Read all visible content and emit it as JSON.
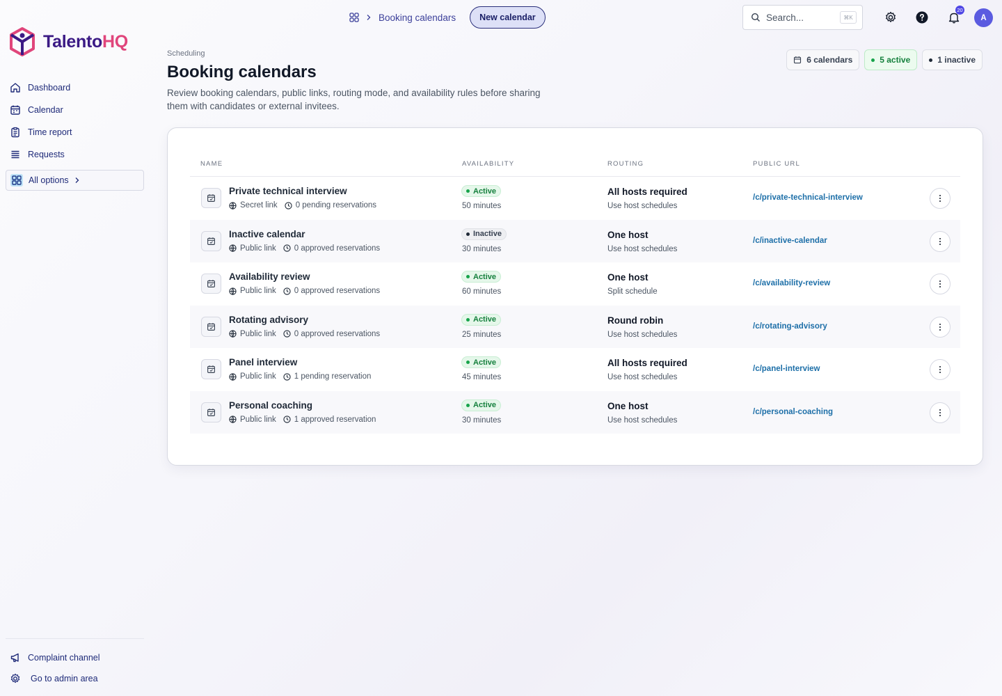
{
  "app": {
    "brand_part1": "Talento",
    "brand_part2": "HQ"
  },
  "sidebar": {
    "items": [
      {
        "label": "Dashboard",
        "icon": "home-icon"
      },
      {
        "label": "Calendar",
        "icon": "calendar-icon"
      },
      {
        "label": "Time report",
        "icon": "clipboard-icon"
      },
      {
        "label": "Requests",
        "icon": "list-icon"
      }
    ],
    "all_options": "All options",
    "bottom": [
      {
        "label": "Complaint channel",
        "icon": "megaphone-icon"
      },
      {
        "label": "Go to admin area",
        "icon": "gear-icon"
      }
    ]
  },
  "topbar": {
    "breadcrumb": "Booking calendars",
    "new_calendar": "New calendar",
    "search_placeholder": "Search...",
    "search_shortcut": "⌘K",
    "notification_count": "20",
    "avatar_initial": "A"
  },
  "header": {
    "eyebrow": "Scheduling",
    "title": "Booking calendars",
    "description": "Review booking calendars, public links, routing mode, and availability rules before sharing them with candidates or external invitees.",
    "stats": {
      "calendars": "6 calendars",
      "active": "5 active",
      "inactive": "1 inactive"
    }
  },
  "table": {
    "columns": [
      "NAME",
      "AVAILABILITY",
      "ROUTING",
      "PUBLIC URL"
    ],
    "rows": [
      {
        "name": "Private technical interview",
        "link": "Secret link",
        "reservations": "0 pending reservations",
        "status": "Active",
        "duration": "50 minutes",
        "routing": "All hosts required",
        "schedule": "Use host schedules",
        "url": "/c/private-technical-interview"
      },
      {
        "name": "Inactive calendar",
        "link": "Public link",
        "reservations": "0 approved reservations",
        "status": "Inactive",
        "duration": "30 minutes",
        "routing": "One host",
        "schedule": "Use host schedules",
        "url": "/c/inactive-calendar"
      },
      {
        "name": "Availability review",
        "link": "Public link",
        "reservations": "0 approved reservations",
        "status": "Active",
        "duration": "60 minutes",
        "routing": "One host",
        "schedule": "Split schedule",
        "url": "/c/availability-review"
      },
      {
        "name": "Rotating advisory",
        "link": "Public link",
        "reservations": "0 approved reservations",
        "status": "Active",
        "duration": "25 minutes",
        "routing": "Round robin",
        "schedule": "Use host schedules",
        "url": "/c/rotating-advisory"
      },
      {
        "name": "Panel interview",
        "link": "Public link",
        "reservations": "1 pending reservation",
        "status": "Active",
        "duration": "45 minutes",
        "routing": "All hosts required",
        "schedule": "Use host schedules",
        "url": "/c/panel-interview"
      },
      {
        "name": "Personal coaching",
        "link": "Public link",
        "reservations": "1 approved reservation",
        "status": "Active",
        "duration": "30 minutes",
        "routing": "One host",
        "schedule": "Use host schedules",
        "url": "/c/personal-coaching"
      }
    ]
  },
  "colors": {
    "brand_purple": "#3b1a85",
    "brand_pink": "#e0457b",
    "link_blue": "#1d6fa8",
    "active_green": "#15803d",
    "nav_text": "#1e2a78"
  }
}
